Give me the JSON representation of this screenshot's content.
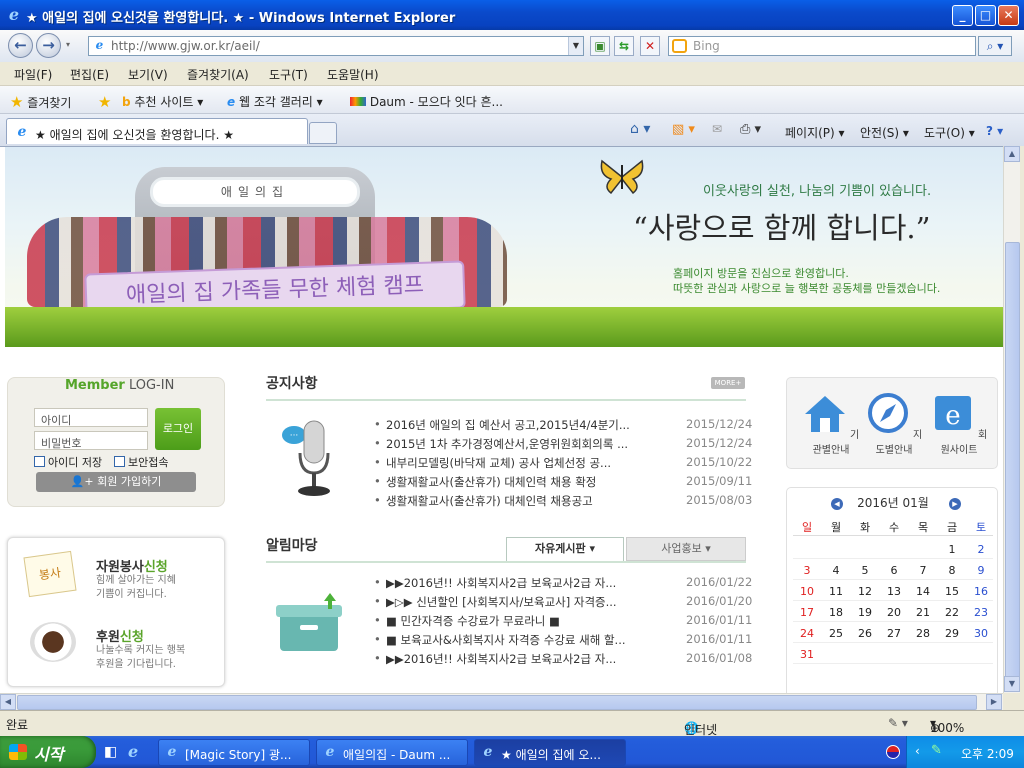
{
  "window": {
    "title": "★ 애일의 집에 오신것을 환영합니다. ★ - Windows Internet Explorer",
    "minimize": "_",
    "maximize": "□",
    "close": "✕"
  },
  "address": {
    "url": "http://www.gjw.or.kr/aeil/",
    "search_placeholder": "Bing"
  },
  "menu": [
    "파일(F)",
    "편집(E)",
    "보기(V)",
    "즐겨찾기(A)",
    "도구(T)",
    "도움말(H)"
  ],
  "favorites": {
    "label": "즐겨찾기",
    "items": [
      "추천 사이트 ▾",
      "웹 조각 갤러리 ▾",
      "Daum - 모으다 잇다 흔..."
    ]
  },
  "tab": {
    "title": "★ 애일의 집에 오신것을 환영합니다. ★",
    "tools": [
      "페이지(P) ▾",
      "안전(S) ▾",
      "도구(O) ▾"
    ]
  },
  "banner": {
    "sign": "애일의집",
    "band": "애일의 집 가족들 무한 체험 캠프",
    "subtitle": "이웃사랑의 실천, 나눔의 기쁨이 있습니다.",
    "headline": "“사랑으로 함께 합니다.”",
    "welcome1": "홈페이지 방문을 진심으로 환영합니다.",
    "welcome2": "따뜻한 관심과 사랑으로 늘 행복한 공동체를 만들겠습니다."
  },
  "login": {
    "title_member": "Member",
    "title_login": " LOG-IN",
    "id_placeholder": "아이디",
    "pw_placeholder": "비밀번호",
    "login_button": "로그인",
    "save_id": "아이디 저장",
    "secure": "보안접속",
    "join": "회원 가입하기"
  },
  "volunteer": {
    "title_a": "자원봉사",
    "title_b": "신청",
    "desc1": "힘께 살아가는 지혜",
    "desc2": "기쁨이 커집니다.",
    "sign": "봉사",
    "donate_title_a": "후원",
    "donate_title_b": "신청",
    "donate_desc1": "나눌수록 커지는 행복",
    "donate_desc2": "후원을 기다립니다."
  },
  "notice": {
    "title": "공지사항",
    "more": "MORE+",
    "rows": [
      {
        "title": "2016년 애일의 집 예산서 공고,2015년4/4분기...",
        "date": "2015/12/24"
      },
      {
        "title": "2015년 1차 추가경정예산서,운영위원회회의록 ...",
        "date": "2015/12/24"
      },
      {
        "title": "내부리모델링(바닥재 교체) 공사 업체선정 공...",
        "date": "2015/10/22"
      },
      {
        "title": "생활재활교사(출산휴가) 대체인력 채용 확정",
        "date": "2015/09/11"
      },
      {
        "title": "생활재활교사(출산휴가) 대체인력 채용공고",
        "date": "2015/08/03"
      }
    ]
  },
  "board": {
    "title": "알림마당",
    "tab_active": "자유게시판 ▾",
    "tab_other": "사업홍보 ▾",
    "rows": [
      {
        "title": "▶▶2016년!! 사회복지사2급 보육교사2급 자...",
        "date": "2016/01/22"
      },
      {
        "title": "▶▷▶ 신년할인 [사회복지사/보육교사] 자격증...",
        "date": "2016/01/20"
      },
      {
        "title": "■ 민간자격증 수강료가 무료라니 ■",
        "date": "2016/01/11"
      },
      {
        "title": "■ 보육교사&사회복지사 자격증 수강료 새해 할...",
        "date": "2016/01/11"
      },
      {
        "title": "▶▶2016년!! 사회복지사2급 보육교사2급 자...",
        "date": "2016/01/08"
      }
    ]
  },
  "quick": [
    "기관별안내",
    "지도별안내",
    "회원사이트"
  ],
  "calendar": {
    "month": "2016년 01월",
    "dow": [
      "일",
      "월",
      "화",
      "수",
      "목",
      "금",
      "토"
    ],
    "weeks": [
      [
        "",
        "",
        "",
        "",
        "",
        "1",
        "2"
      ],
      [
        "3",
        "4",
        "5",
        "6",
        "7",
        "8",
        "9"
      ],
      [
        "10",
        "11",
        "12",
        "13",
        "14",
        "15",
        "16"
      ],
      [
        "17",
        "18",
        "19",
        "20",
        "21",
        "22",
        "23"
      ],
      [
        "24",
        "25",
        "26",
        "27",
        "28",
        "29",
        "30"
      ],
      [
        "31",
        "",
        "",
        "",
        "",
        "",
        ""
      ]
    ]
  },
  "status": {
    "left": "완료",
    "zone": "인터넷",
    "zoom": "100%"
  },
  "taskbar": {
    "start": "시작",
    "items": [
      "[Magic Story] 광...",
      "애일의집 - Daum ...",
      "★ 애일의 집에 오..."
    ],
    "clock": "오후 2:09"
  },
  "colors": {
    "xp_blue": "#0A4ACB",
    "accent_green": "#5aa42a",
    "sunday_red": "#e02020",
    "saturday_blue": "#2a4fd0"
  }
}
